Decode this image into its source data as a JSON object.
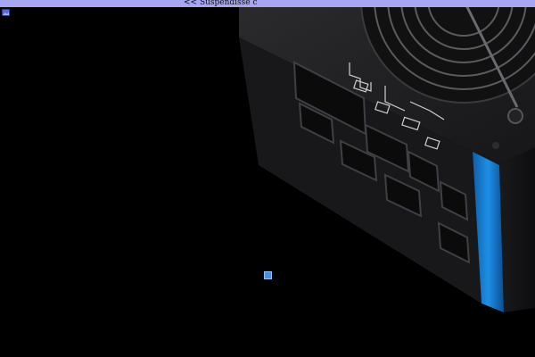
{
  "window": {
    "title": "<< Suspendisse c"
  },
  "image": {
    "subject": "psu-photo",
    "accent_color": "#1d83d8",
    "case_color": "#1e1e20"
  },
  "icons": {
    "corner": "image-icon",
    "overlay": "small-square-button"
  }
}
